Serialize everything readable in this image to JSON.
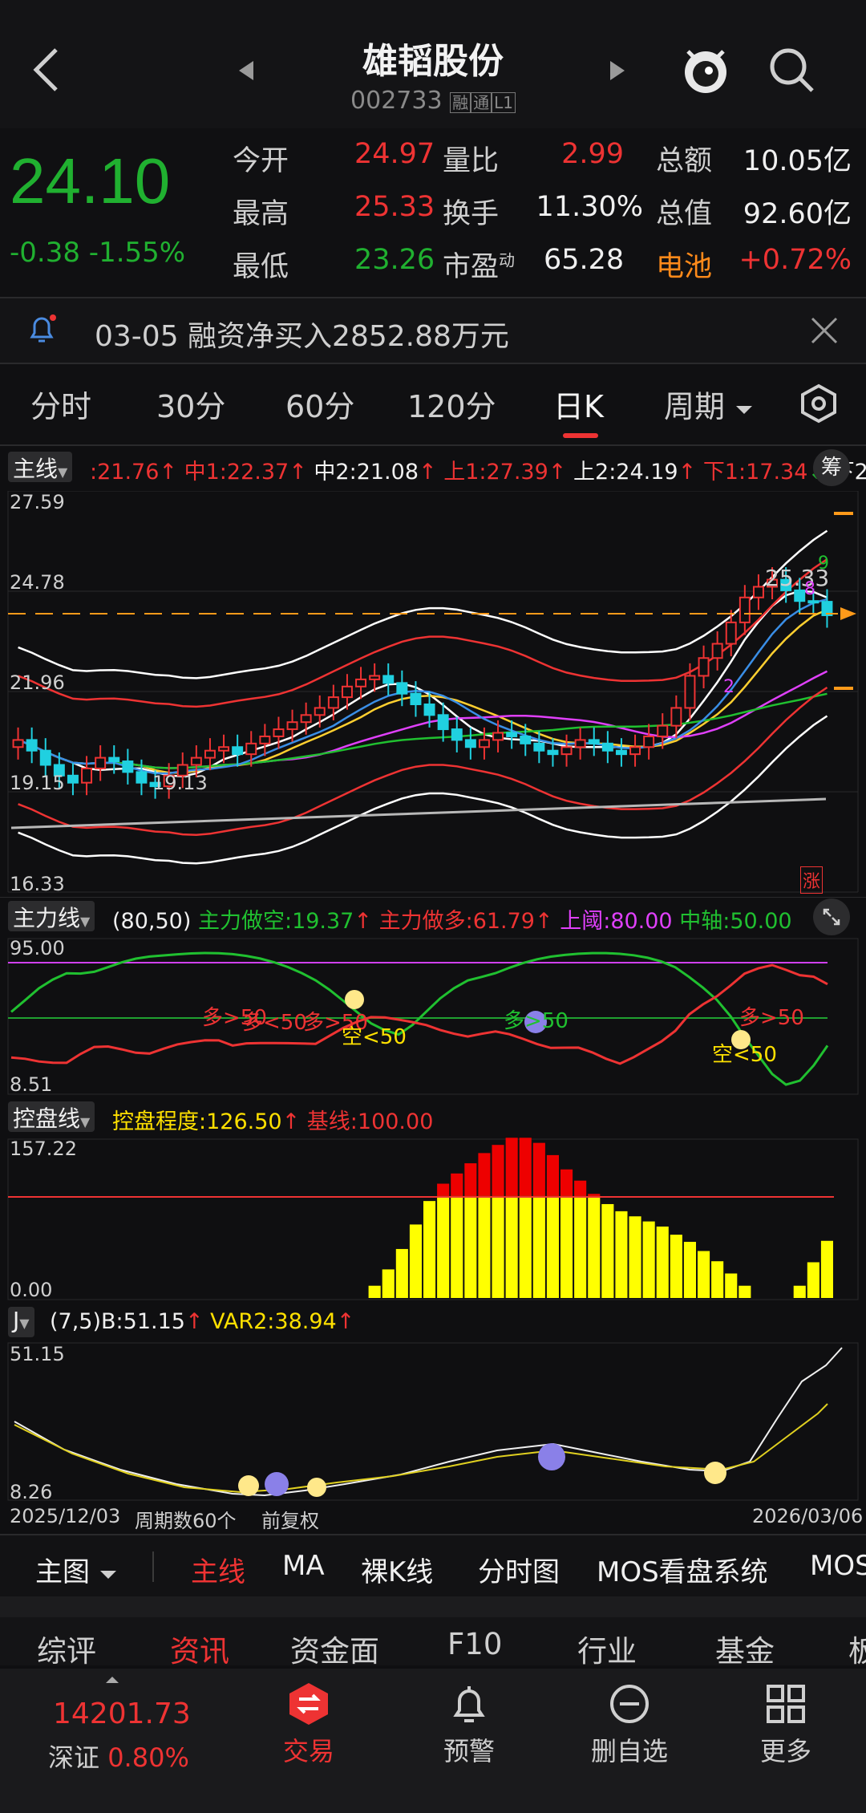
{
  "header": {
    "title": "雄韬股份",
    "code": "002733",
    "badges": [
      "融",
      "通",
      "L1"
    ]
  },
  "quote": {
    "price": "24.10",
    "change": "-0.38",
    "change_pct": "-1.55%",
    "rows": [
      {
        "l1": "今开",
        "v1": "24.97",
        "l2": "量比",
        "v2": "2.99",
        "l3": "总额",
        "v3": "10.05亿"
      },
      {
        "l1": "最高",
        "v1": "25.33",
        "l2": "换手",
        "v2": "11.30%",
        "l3": "总值",
        "v3": "92.60亿"
      },
      {
        "l1": "最低",
        "v1": "23.26",
        "l2": "市盈",
        "l2_sup": "动",
        "v2": "65.28",
        "l3": "电池",
        "v3": "+0.72%"
      }
    ]
  },
  "notice": {
    "text": "03-05 融资净买入2852.88万元"
  },
  "period_tabs": [
    "分时",
    "30分",
    "60分",
    "120分",
    "日K",
    "周期"
  ],
  "active_period": "日K",
  "main_chart": {
    "selector": "主线",
    "legend": [
      {
        "text": ":21.76",
        "color": "#ee3333"
      },
      {
        "text": "中1:22.37",
        "color": "#ee3333"
      },
      {
        "text": "中2:21.08",
        "color": "#f0f0f0"
      },
      {
        "text": "上1:27.39",
        "color": "#ee3333"
      },
      {
        "text": "上2:24.19",
        "color": "#f0f0f0"
      },
      {
        "text": "下1:17.34",
        "color": "#ee3333"
      },
      {
        "text": "下2",
        "color": "#f0f0f0"
      }
    ],
    "chip_label": "筹",
    "y_labels": [
      "27.59",
      "24.78",
      "21.96",
      "19.15",
      "16.33"
    ],
    "high_label": "25.33",
    "low_label": "19.13",
    "limit_badge": "涨",
    "annot_9": "9",
    "annot_8": "8",
    "annot_2": "2"
  },
  "chart_data": {
    "type": "candlestick",
    "period": "daily",
    "ylim": [
      16.33,
      27.59
    ],
    "closes": [
      20.6,
      20.3,
      19.9,
      19.6,
      19.4,
      19.8,
      20.1,
      20.0,
      19.7,
      19.4,
      19.3,
      19.6,
      19.9,
      20.1,
      20.3,
      20.4,
      20.2,
      20.5,
      20.7,
      20.9,
      21.1,
      21.3,
      21.5,
      21.8,
      22.1,
      22.3,
      22.4,
      22.2,
      21.9,
      21.6,
      21.3,
      20.9,
      20.6,
      20.4,
      20.6,
      20.8,
      20.7,
      20.5,
      20.3,
      20.2,
      20.4,
      20.6,
      20.5,
      20.3,
      20.2,
      20.4,
      20.7,
      21.0,
      21.5,
      22.4,
      22.9,
      23.3,
      23.9,
      24.6,
      24.9,
      25.1,
      24.8,
      24.5,
      24.48,
      24.1
    ],
    "high": 25.33,
    "low": 19.13,
    "markers": {
      "high": 25.33,
      "low": 19.13,
      "dashed_level": 24.48
    }
  },
  "indicator1": {
    "selector": "主力线",
    "params": "(80,50)",
    "legend": [
      {
        "text": "主力做空:19.37",
        "color": "#20c030"
      },
      {
        "text": "主力做多:61.79",
        "color": "#ee3333"
      },
      {
        "text": "上阈:80.00",
        "color": "#e040fb"
      },
      {
        "text": "中轴:50.00",
        "color": "#20c030"
      }
    ],
    "y_labels": [
      "95.00",
      "8.51"
    ],
    "annotations": [
      "多>50",
      "多<50",
      "多>50",
      "空<50",
      "多>50",
      "多>50",
      "空<50"
    ]
  },
  "indicator2": {
    "selector": "控盘线",
    "legend": [
      {
        "text": "控盘程度:126.50",
        "color": "#ffe000"
      },
      {
        "text": "基线:100.00",
        "color": "#ee3333"
      }
    ],
    "y_labels": [
      "157.22",
      "0.00"
    ],
    "values": [
      0,
      0,
      0,
      0,
      0,
      0,
      0,
      0,
      0,
      0,
      0,
      0,
      0,
      0,
      0,
      0,
      0,
      0,
      0,
      0,
      0,
      0,
      0,
      0,
      0,
      0,
      12,
      28,
      48,
      72,
      95,
      112,
      122,
      132,
      142,
      150,
      157,
      157,
      152,
      140,
      126,
      115,
      102,
      92,
      85,
      80,
      75,
      70,
      62,
      55,
      46,
      36,
      24,
      12,
      0,
      0,
      0,
      12,
      35,
      56
    ]
  },
  "indicator3": {
    "selector": "J",
    "params": "(7,5)",
    "legend": [
      {
        "text": "B:51.15",
        "color": "#f0f0f0"
      },
      {
        "text": "VAR2:38.94",
        "color": "#ffe000"
      }
    ],
    "y_labels": [
      "51.15",
      "8.26"
    ]
  },
  "footer_info": {
    "start": "2025/12/03",
    "count": "周期数60个",
    "adjust": "前复权",
    "end": "2026/03/06"
  },
  "main_tabs": {
    "selector": "主图",
    "items": [
      "主线",
      "MA",
      "裸K线",
      "分时图",
      "MOS看盘系统",
      "MOS"
    ]
  },
  "info_tabs": [
    "综评",
    "资讯",
    "资金面",
    "F10",
    "行业",
    "基金",
    "板"
  ],
  "active_info_tab": "资讯",
  "index": {
    "value": "14201.73",
    "name": "深证",
    "pct": "0.80%"
  },
  "bottom_nav": [
    {
      "label": "交易",
      "icon": "trade-icon"
    },
    {
      "label": "预警",
      "icon": "bell-icon"
    },
    {
      "label": "删自选",
      "icon": "minus-circle-icon"
    },
    {
      "label": "更多",
      "icon": "grid-icon"
    }
  ]
}
